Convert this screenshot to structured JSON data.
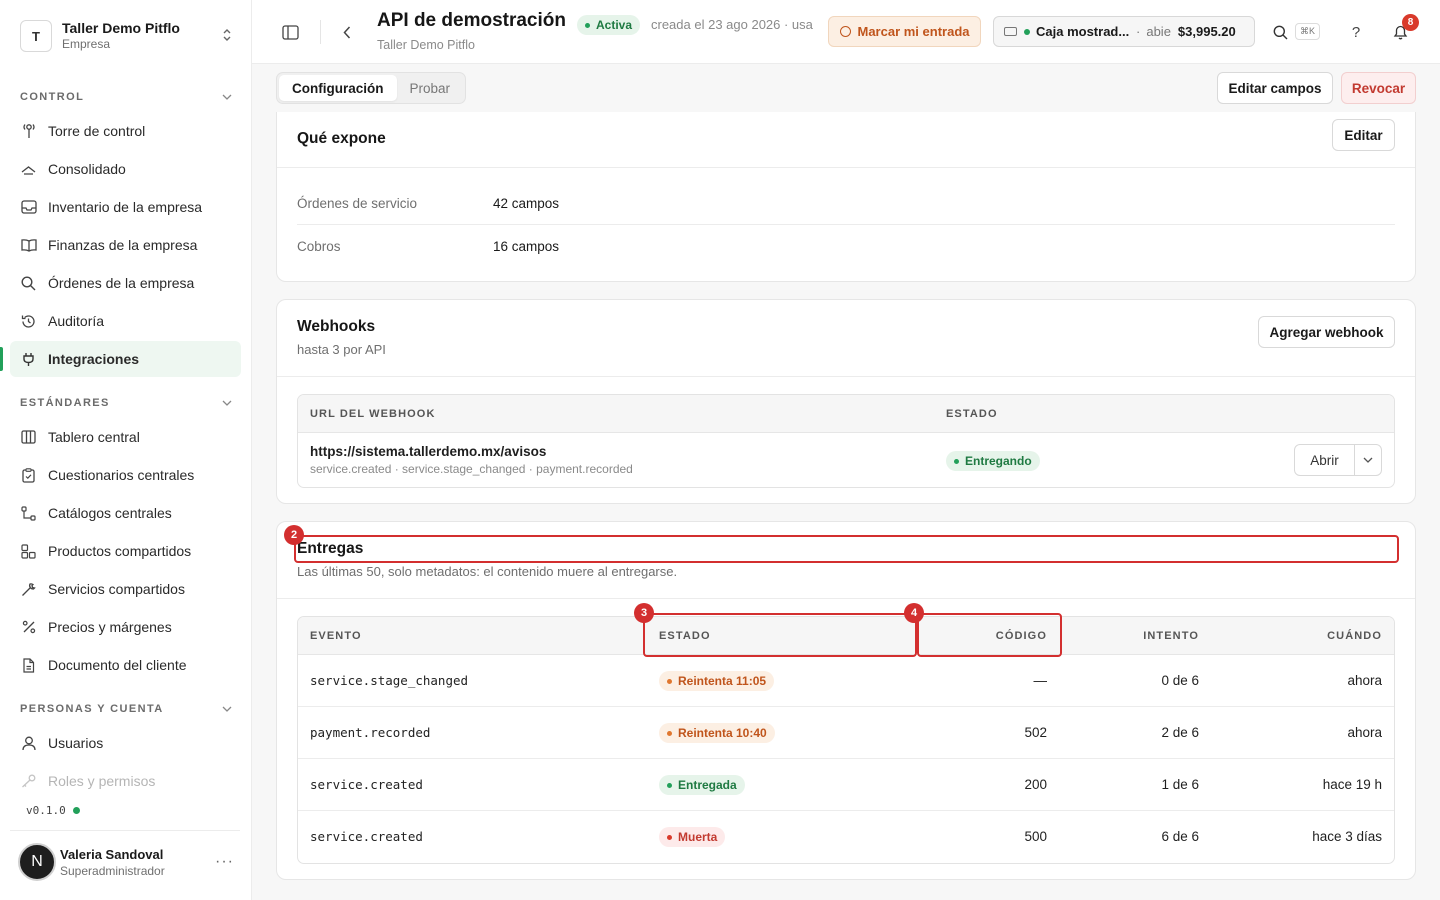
{
  "org": {
    "initial": "T",
    "name": "Taller Demo Pitflo",
    "type": "Empresa"
  },
  "sidebar": {
    "sections": [
      {
        "label": "CONTROL",
        "items": [
          {
            "label": "Torre de control",
            "icon": "tower-icon"
          },
          {
            "label": "Consolidado",
            "icon": "layers-icon"
          },
          {
            "label": "Inventario de la empresa",
            "icon": "inbox-icon"
          },
          {
            "label": "Finanzas de la empresa",
            "icon": "book-icon"
          },
          {
            "label": "Órdenes de la empresa",
            "icon": "search-icon"
          },
          {
            "label": "Auditoría",
            "icon": "history-icon"
          },
          {
            "label": "Integraciones",
            "icon": "plug-icon",
            "active": true
          }
        ]
      },
      {
        "label": "ESTÁNDARES",
        "items": [
          {
            "label": "Tablero central",
            "icon": "columns-icon"
          },
          {
            "label": "Cuestionarios centrales",
            "icon": "clipboard-icon"
          },
          {
            "label": "Catálogos centrales",
            "icon": "tree-icon"
          },
          {
            "label": "Productos compartidos",
            "icon": "boxes-icon"
          },
          {
            "label": "Servicios compartidos",
            "icon": "wrench-icon"
          },
          {
            "label": "Precios y márgenes",
            "icon": "percent-icon"
          },
          {
            "label": "Documento del cliente",
            "icon": "document-icon"
          }
        ]
      },
      {
        "label": "PERSONAS Y CUENTA",
        "items": [
          {
            "label": "Usuarios",
            "icon": "user-icon"
          },
          {
            "label": "Roles y permisos",
            "icon": "key-icon"
          }
        ]
      }
    ],
    "version": "v0.1.0"
  },
  "user": {
    "initial": "N",
    "name": "Valeria Sandoval",
    "role": "Superadministrador"
  },
  "header": {
    "title": "API de demostración",
    "subtitle": "Taller Demo Pitflo",
    "status": "Activa",
    "created": "creada el 23 ago 2026 · usa",
    "entry_button": "Marcar mi entrada",
    "cashbox": {
      "name": "Caja mostrad...",
      "state": "abie",
      "amount": "$3,995.20"
    },
    "shortcut": "⌘K",
    "help": "?",
    "notifications": "8"
  },
  "toolbar": {
    "tabs": [
      {
        "label": "Configuración",
        "active": true
      },
      {
        "label": "Probar"
      }
    ],
    "edit_fields": "Editar campos",
    "revoke": "Revocar"
  },
  "exposes": {
    "title": "Qué expone",
    "edit": "Editar",
    "rows": [
      {
        "key": "Órdenes de servicio",
        "value": "42 campos"
      },
      {
        "key": "Cobros",
        "value": "16 campos"
      }
    ]
  },
  "webhooks": {
    "title": "Webhooks",
    "subtitle": "hasta 3 por API",
    "add": "Agregar webhook",
    "columns": {
      "url": "URL DEL WEBHOOK",
      "status": "ESTADO"
    },
    "rows": [
      {
        "url": "https://sistema.tallerdemo.mx/avisos",
        "events": "service.created · service.stage_changed · payment.recorded",
        "status": "Entregando",
        "open": "Abrir"
      }
    ]
  },
  "deliveries": {
    "title": "Entregas",
    "subtitle": "Las últimas 50, solo metadatos: el contenido muere al entregarse.",
    "columns": {
      "event": "EVENTO",
      "status": "ESTADO",
      "code": "CÓDIGO",
      "attempt": "INTENTO",
      "when": "CUÁNDO"
    },
    "rows": [
      {
        "event": "service.stage_changed",
        "status": "Reintenta 11:05",
        "kind": "warn",
        "code": "—",
        "attempt": "0 de 6",
        "when": "ahora"
      },
      {
        "event": "payment.recorded",
        "status": "Reintenta 10:40",
        "kind": "warn",
        "code": "502",
        "attempt": "2 de 6",
        "when": "ahora"
      },
      {
        "event": "service.created",
        "status": "Entregada",
        "kind": "ok",
        "code": "200",
        "attempt": "1 de 6",
        "when": "hace 19 h"
      },
      {
        "event": "service.created",
        "status": "Muerta",
        "kind": "dead",
        "code": "500",
        "attempt": "6 de 6",
        "when": "hace 3 días"
      }
    ]
  },
  "annotations": [
    "2",
    "3",
    "4"
  ],
  "colors": {
    "accent": "#22a05a",
    "warn": "#c0551c",
    "danger": "#c23a30",
    "highlight": "#d32f2f"
  }
}
